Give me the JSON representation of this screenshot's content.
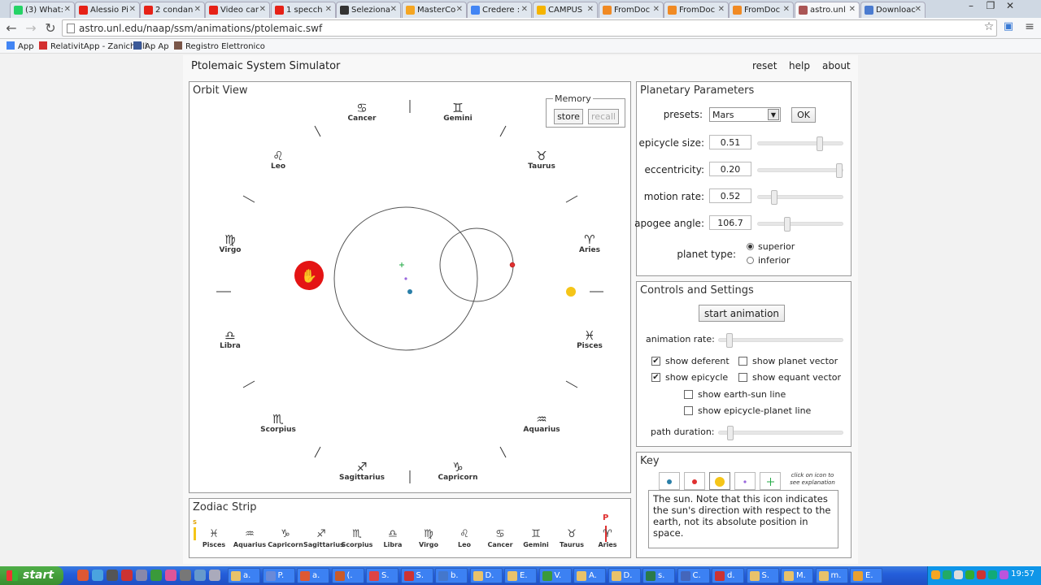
{
  "browser": {
    "tabs": [
      {
        "title": "(3) What:",
        "color": "#25d366"
      },
      {
        "title": "Alessio Pi",
        "color": "#e62117"
      },
      {
        "title": "2 condan",
        "color": "#e62117"
      },
      {
        "title": "Video car",
        "color": "#e62117"
      },
      {
        "title": "1 specch",
        "color": "#e62117"
      },
      {
        "title": "Seleziona",
        "color": "#333333"
      },
      {
        "title": "MasterCo",
        "color": "#f5a623"
      },
      {
        "title": "Credere :",
        "color": "#4285f4"
      },
      {
        "title": "CAMPUS",
        "color": "#f5b400"
      },
      {
        "title": "FromDoc",
        "color": "#f08a24"
      },
      {
        "title": "FromDoc",
        "color": "#f08a24"
      },
      {
        "title": "FromDoc",
        "color": "#f08a24"
      },
      {
        "title": "astro.unl",
        "color": "#aa5555"
      },
      {
        "title": "Downloac",
        "color": "#4a7bd0"
      }
    ],
    "url": "astro.unl.edu/naap/ssm/animations/ptolemaic.swf",
    "bookmarks": [
      {
        "label": "App",
        "color": "#4285f4"
      },
      {
        "label": "RelativitApp - Zanichelli",
        "color": "#d32f2f"
      },
      {
        "label": "Ap Ap",
        "color": "#3b5998"
      },
      {
        "label": "Registro Elettronico",
        "color": "#795548"
      }
    ]
  },
  "app": {
    "title": "Ptolemaic System Simulator",
    "menu": {
      "reset": "reset",
      "help": "help",
      "about": "about"
    },
    "orbit_view": {
      "title": "Orbit View",
      "memory_label": "Memory",
      "store": "store",
      "recall": "recall",
      "signs": [
        {
          "name": "Cancer",
          "sym": "♋"
        },
        {
          "name": "Gemini",
          "sym": "♊"
        },
        {
          "name": "Leo",
          "sym": "♌"
        },
        {
          "name": "Taurus",
          "sym": "♉"
        },
        {
          "name": "Virgo",
          "sym": "♍"
        },
        {
          "name": "Aries",
          "sym": "♈"
        },
        {
          "name": "Libra",
          "sym": "♎"
        },
        {
          "name": "Pisces",
          "sym": "♓"
        },
        {
          "name": "Scorpius",
          "sym": "♏"
        },
        {
          "name": "Aquarius",
          "sym": "♒"
        },
        {
          "name": "Sagittarius",
          "sym": "♐"
        },
        {
          "name": "Capricorn",
          "sym": "♑"
        }
      ]
    },
    "params": {
      "title": "Planetary Parameters",
      "presets_label": "presets:",
      "preset_value": "Mars",
      "ok": "OK",
      "epicycle_size_label": "epicycle size:",
      "epicycle_size": "0.51",
      "epicycle_size_pos": 0.75,
      "eccentricity_label": "eccentricity:",
      "eccentricity": "0.20",
      "eccentricity_pos": 1.0,
      "motion_rate_label": "motion rate:",
      "motion_rate": "0.52",
      "motion_rate_pos": 0.17,
      "apogee_angle_label": "apogee angle:",
      "apogee_angle": "106.7",
      "apogee_angle_pos": 0.33,
      "planet_type_label": "planet type:",
      "superior": "superior",
      "inferior": "inferior",
      "selected_type": "superior"
    },
    "controls": {
      "title": "Controls and Settings",
      "start_animation": "start animation",
      "animation_rate_label": "animation rate:",
      "animation_rate_pos": 0.06,
      "show_deferent": "show deferent",
      "show_epicycle": "show epicycle",
      "show_planet_vector": "show planet vector",
      "show_equant_vector": "show equant vector",
      "show_earth_sun_line": "show earth-sun line",
      "show_epicycle_planet_line": "show epicycle-planet line",
      "path_duration_label": "path duration:",
      "path_duration_pos": 0.07,
      "deferent_checked": true,
      "epicycle_checked": true
    },
    "key": {
      "title": "Key",
      "hint": "click on icon to see explanation",
      "explanation": "The sun. Note that this icon indicates the sun's direction with respect to the earth, not its absolute position in space.",
      "colors": {
        "earth": "#2a7fa8",
        "planet": "#e03030",
        "sun": "#f5c518",
        "equant": "#9966dd",
        "center": "#22aa44"
      }
    },
    "zodiac_strip": {
      "title": "Zodiac Strip",
      "sun_marker": "S",
      "planet_marker": "P",
      "signs": [
        {
          "name": "Pisces",
          "sym": "♓"
        },
        {
          "name": "Aquarius",
          "sym": "♒"
        },
        {
          "name": "Capricorn",
          "sym": "♑"
        },
        {
          "name": "Sagittarius",
          "sym": "♐"
        },
        {
          "name": "Scorpius",
          "sym": "♏"
        },
        {
          "name": "Libra",
          "sym": "♎"
        },
        {
          "name": "Virgo",
          "sym": "♍"
        },
        {
          "name": "Leo",
          "sym": "♌"
        },
        {
          "name": "Cancer",
          "sym": "♋"
        },
        {
          "name": "Gemini",
          "sym": "♊"
        },
        {
          "name": "Taurus",
          "sym": "♉"
        },
        {
          "name": "Aries",
          "sym": "♈"
        }
      ]
    }
  },
  "taskbar": {
    "start": "start",
    "buttons": [
      "a.",
      "P.",
      "a.",
      "(.",
      "S.",
      "S.",
      "b.",
      "D.",
      "E.",
      "V.",
      "A.",
      "D.",
      "s.",
      "C.",
      "d.",
      "S.",
      "M.",
      "m.",
      "E."
    ],
    "clock": "19:57"
  }
}
